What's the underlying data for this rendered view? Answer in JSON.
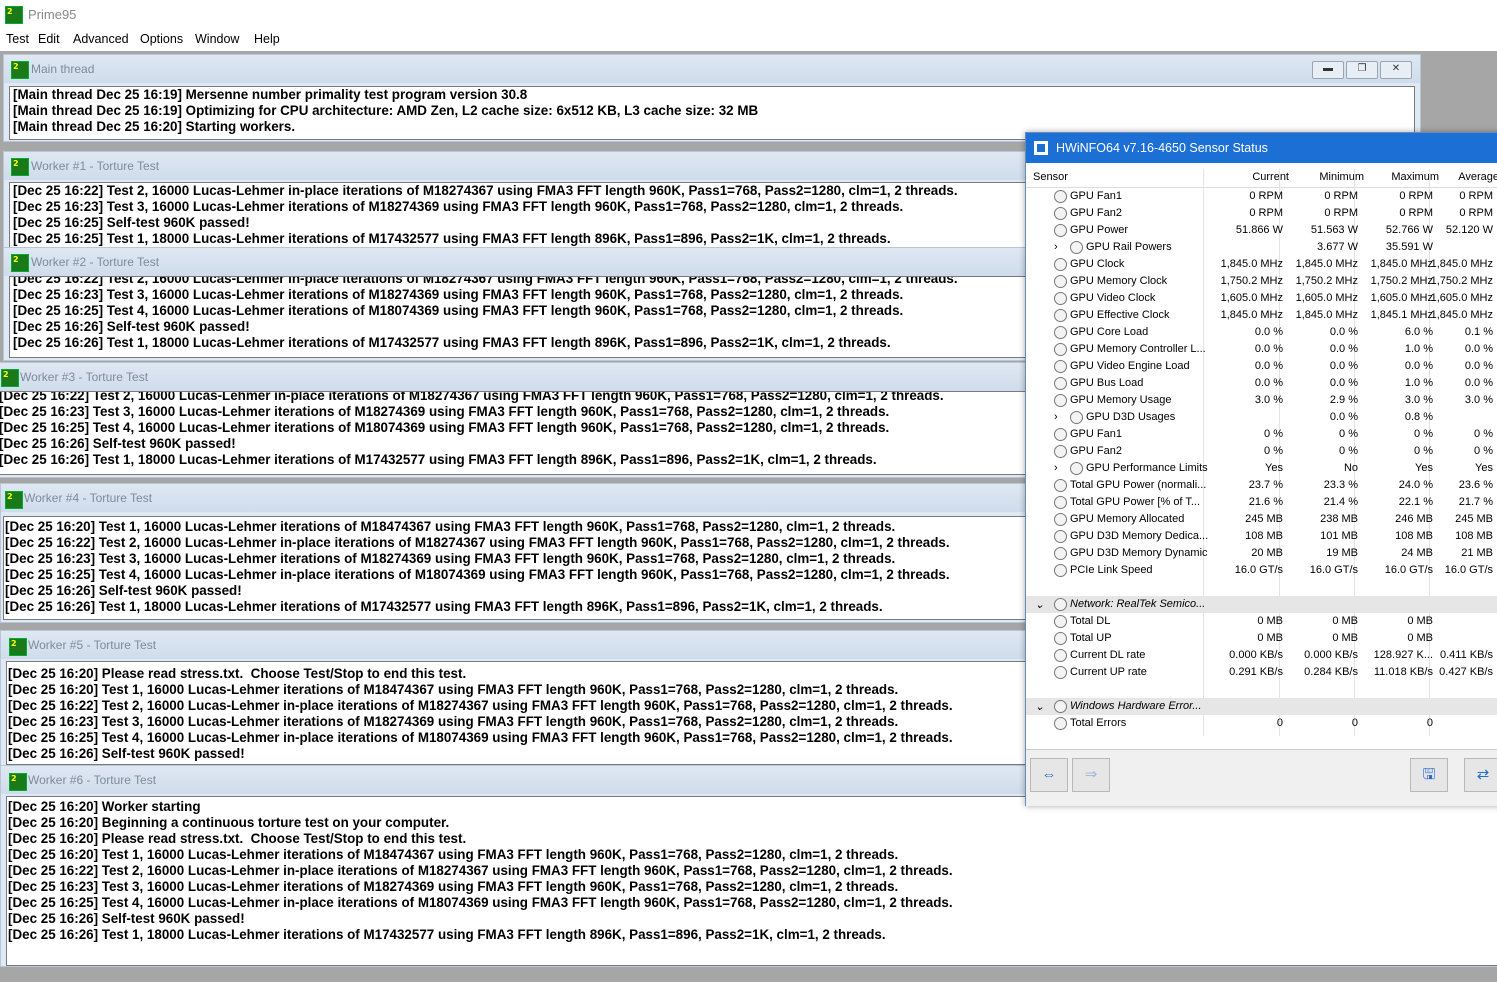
{
  "app": {
    "title": "Prime95"
  },
  "menu": [
    "Test",
    "Edit",
    "Advanced",
    "Options",
    "Window",
    "Help"
  ],
  "windows": [
    {
      "title": "Main thread",
      "lines": [
        "[Main thread Dec 25 16:19] Mersenne number primality test program version 30.8",
        "[Main thread Dec 25 16:19] Optimizing for CPU architecture: AMD Zen, L2 cache size: 6x512 KB, L3 cache size: 32 MB",
        "[Main thread Dec 25 16:20] Starting workers."
      ]
    },
    {
      "title": "Worker #1 - Torture Test",
      "lines": [
        "[Dec 25 16:22] Test 2, 16000 Lucas-Lehmer in-place iterations of M18274367 using FMA3 FFT length 960K, Pass1=768, Pass2=1280, clm=1, 2 threads.",
        "[Dec 25 16:23] Test 3, 16000 Lucas-Lehmer iterations of M18274369 using FMA3 FFT length 960K, Pass1=768, Pass2=1280, clm=1, 2 threads.",
        "[Dec 25 16:25] Self-test 960K passed!",
        "[Dec 25 16:25] Test 1, 18000 Lucas-Lehmer iterations of M17432577 using FMA3 FFT length 896K, Pass1=896, Pass2=1K, clm=1, 2 threads."
      ]
    },
    {
      "title": "Worker #2 - Torture Test",
      "lines": [
        "[Dec 25 16:22] Test 2, 16000 Lucas-Lehmer in-place iterations of M18274367 using FMA3 FFT length 960K, Pass1=768, Pass2=1280, clm=1, 2 threads.",
        "[Dec 25 16:23] Test 3, 16000 Lucas-Lehmer iterations of M18274369 using FMA3 FFT length 960K, Pass1=768, Pass2=1280, clm=1, 2 threads.",
        "[Dec 25 16:25] Test 4, 16000 Lucas-Lehmer iterations of M18074369 using FMA3 FFT length 960K, Pass1=768, Pass2=1280, clm=1, 2 threads.",
        "[Dec 25 16:26] Self-test 960K passed!",
        "[Dec 25 16:26] Test 1, 18000 Lucas-Lehmer iterations of M17432577 using FMA3 FFT length 896K, Pass1=896, Pass2=1K, clm=1, 2 threads."
      ]
    },
    {
      "title": "Worker #3 - Torture Test",
      "lines": [
        "[Dec 25 16:22] Test 2, 16000 Lucas-Lehmer in-place iterations of M18274367 using FMA3 FFT length 960K, Pass1=768, Pass2=1280, clm=1, 2 threads.",
        "[Dec 25 16:23] Test 3, 16000 Lucas-Lehmer iterations of M18274369 using FMA3 FFT length 960K, Pass1=768, Pass2=1280, clm=1, 2 threads.",
        "[Dec 25 16:25] Test 4, 16000 Lucas-Lehmer iterations of M18074369 using FMA3 FFT length 960K, Pass1=768, Pass2=1280, clm=1, 2 threads.",
        "[Dec 25 16:26] Self-test 960K passed!",
        "[Dec 25 16:26] Test 1, 18000 Lucas-Lehmer iterations of M17432577 using FMA3 FFT length 896K, Pass1=896, Pass2=1K, clm=1, 2 threads."
      ]
    },
    {
      "title": "Worker #4 - Torture Test",
      "lines": [
        "[Dec 25 16:20] Test 1, 16000 Lucas-Lehmer iterations of M18474367 using FMA3 FFT length 960K, Pass1=768, Pass2=1280, clm=1, 2 threads.",
        "[Dec 25 16:22] Test 2, 16000 Lucas-Lehmer in-place iterations of M18274367 using FMA3 FFT length 960K, Pass1=768, Pass2=1280, clm=1, 2 threads.",
        "[Dec 25 16:23] Test 3, 16000 Lucas-Lehmer iterations of M18274369 using FMA3 FFT length 960K, Pass1=768, Pass2=1280, clm=1, 2 threads.",
        "[Dec 25 16:25] Test 4, 16000 Lucas-Lehmer in-place iterations of M18074369 using FMA3 FFT length 960K, Pass1=768, Pass2=1280, clm=1, 2 threads.",
        "[Dec 25 16:26] Self-test 960K passed!",
        "[Dec 25 16:26] Test 1, 18000 Lucas-Lehmer iterations of M17432577 using FMA3 FFT length 896K, Pass1=896, Pass2=1K, clm=1, 2 threads."
      ]
    },
    {
      "title": "Worker #5 - Torture Test",
      "lines": [
        "[Dec 25 16:20] Please read stress.txt.  Choose Test/Stop to end this test.",
        "[Dec 25 16:20] Test 1, 16000 Lucas-Lehmer iterations of M18474367 using FMA3 FFT length 960K, Pass1=768, Pass2=1280, clm=1, 2 threads.",
        "[Dec 25 16:22] Test 2, 16000 Lucas-Lehmer in-place iterations of M18274367 using FMA3 FFT length 960K, Pass1=768, Pass2=1280, clm=1, 2 threads.",
        "[Dec 25 16:23] Test 3, 16000 Lucas-Lehmer iterations of M18274369 using FMA3 FFT length 960K, Pass1=768, Pass2=1280, clm=1, 2 threads.",
        "[Dec 25 16:25] Test 4, 16000 Lucas-Lehmer in-place iterations of M18074369 using FMA3 FFT length 960K, Pass1=768, Pass2=1280, clm=1, 2 threads.",
        "[Dec 25 16:26] Self-test 960K passed!"
      ]
    },
    {
      "title": "Worker #6 - Torture Test",
      "lines": [
        "[Dec 25 16:20] Worker starting",
        "[Dec 25 16:20] Beginning a continuous torture test on your computer.",
        "[Dec 25 16:20] Please read stress.txt.  Choose Test/Stop to end this test.",
        "[Dec 25 16:20] Test 1, 16000 Lucas-Lehmer iterations of M18474367 using FMA3 FFT length 960K, Pass1=768, Pass2=1280, clm=1, 2 threads.",
        "[Dec 25 16:22] Test 2, 16000 Lucas-Lehmer in-place iterations of M18274367 using FMA3 FFT length 960K, Pass1=768, Pass2=1280, clm=1, 2 threads.",
        "[Dec 25 16:23] Test 3, 16000 Lucas-Lehmer iterations of M18274369 using FMA3 FFT length 960K, Pass1=768, Pass2=1280, clm=1, 2 threads.",
        "[Dec 25 16:25] Test 4, 16000 Lucas-Lehmer in-place iterations of M18074369 using FMA3 FFT length 960K, Pass1=768, Pass2=1280, clm=1, 2 threads.",
        "[Dec 25 16:26] Self-test 960K passed!",
        "[Dec 25 16:26] Test 1, 18000 Lucas-Lehmer iterations of M17432577 using FMA3 FFT length 896K, Pass1=896, Pass2=1K, clm=1, 2 threads."
      ]
    }
  ],
  "hwinfo": {
    "title": "HWiNFO64 v7.16-4650 Sensor Status",
    "columns": [
      "Sensor",
      "Current",
      "Minimum",
      "Maximum",
      "Average"
    ],
    "rows": [
      {
        "name": "GPU Fan1",
        "icon": "fan-icon",
        "vals": [
          "0 RPM",
          "0 RPM",
          "0 RPM",
          "0 RPM"
        ]
      },
      {
        "name": "GPU Fan2",
        "icon": "fan-icon",
        "vals": [
          "0 RPM",
          "0 RPM",
          "0 RPM",
          "0 RPM"
        ]
      },
      {
        "name": "GPU Power",
        "icon": "lightning-icon",
        "vals": [
          "51.866 W",
          "51.563 W",
          "52.766 W",
          "52.120 W"
        ]
      },
      {
        "name": "GPU Rail Powers",
        "icon": "lightning-icon",
        "expand": true,
        "vals": [
          "",
          "3.677 W",
          "35.591 W",
          ""
        ]
      },
      {
        "name": "GPU Clock",
        "icon": "gauge-icon",
        "vals": [
          "1,845.0 MHz",
          "1,845.0 MHz",
          "1,845.0 MHz",
          "1,845.0 MHz"
        ]
      },
      {
        "name": "GPU Memory Clock",
        "icon": "gauge-icon",
        "vals": [
          "1,750.2 MHz",
          "1,750.2 MHz",
          "1,750.2 MHz",
          "1,750.2 MHz"
        ]
      },
      {
        "name": "GPU Video Clock",
        "icon": "gauge-icon",
        "vals": [
          "1,605.0 MHz",
          "1,605.0 MHz",
          "1,605.0 MHz",
          "1,605.0 MHz"
        ]
      },
      {
        "name": "GPU Effective Clock",
        "icon": "gauge-icon",
        "vals": [
          "1,845.0 MHz",
          "1,845.0 MHz",
          "1,845.1 MHz",
          "1,845.0 MHz"
        ]
      },
      {
        "name": "GPU Core Load",
        "icon": "gauge-icon",
        "vals": [
          "0.0 %",
          "0.0 %",
          "6.0 %",
          "0.1 %"
        ]
      },
      {
        "name": "GPU Memory Controller L...",
        "icon": "gauge-icon",
        "vals": [
          "0.0 %",
          "0.0 %",
          "1.0 %",
          "0.0 %"
        ]
      },
      {
        "name": "GPU Video Engine Load",
        "icon": "gauge-icon",
        "vals": [
          "0.0 %",
          "0.0 %",
          "0.0 %",
          "0.0 %"
        ]
      },
      {
        "name": "GPU Bus Load",
        "icon": "gauge-icon",
        "vals": [
          "0.0 %",
          "0.0 %",
          "1.0 %",
          "0.0 %"
        ]
      },
      {
        "name": "GPU Memory Usage",
        "icon": "gauge-icon",
        "vals": [
          "3.0 %",
          "2.9 %",
          "3.0 %",
          "3.0 %"
        ]
      },
      {
        "name": "GPU D3D Usages",
        "icon": "gauge-icon",
        "expand": true,
        "vals": [
          "",
          "0.0 %",
          "0.8 %",
          ""
        ]
      },
      {
        "name": "GPU Fan1",
        "icon": "gauge-icon",
        "vals": [
          "0 %",
          "0 %",
          "0 %",
          "0 %"
        ]
      },
      {
        "name": "GPU Fan2",
        "icon": "gauge-icon",
        "vals": [
          "0 %",
          "0 %",
          "0 %",
          "0 %"
        ]
      },
      {
        "name": "GPU Performance Limits",
        "icon": "gauge-icon",
        "expand": true,
        "vals": [
          "Yes",
          "No",
          "Yes",
          "Yes"
        ]
      },
      {
        "name": "Total GPU Power (normali...",
        "icon": "gauge-icon",
        "vals": [
          "23.7 %",
          "23.3 %",
          "24.0 %",
          "23.6 %"
        ]
      },
      {
        "name": "Total GPU Power [% of T...",
        "icon": "gauge-icon",
        "vals": [
          "21.6 %",
          "21.4 %",
          "22.1 %",
          "21.7 %"
        ]
      },
      {
        "name": "GPU Memory Allocated",
        "icon": "gauge-icon",
        "vals": [
          "245 MB",
          "238 MB",
          "246 MB",
          "245 MB"
        ]
      },
      {
        "name": "GPU D3D Memory Dedica...",
        "icon": "gauge-icon",
        "vals": [
          "108 MB",
          "101 MB",
          "108 MB",
          "108 MB"
        ]
      },
      {
        "name": "GPU D3D Memory Dynamic",
        "icon": "gauge-icon",
        "vals": [
          "20 MB",
          "19 MB",
          "24 MB",
          "21 MB"
        ]
      },
      {
        "name": "PCIe Link Speed",
        "icon": "gauge-icon",
        "vals": [
          "16.0 GT/s",
          "16.0 GT/s",
          "16.0 GT/s",
          "16.0 GT/s"
        ]
      },
      {
        "blank": true
      },
      {
        "name": "Network: RealTek Semico...",
        "icon": "network-icon",
        "section": true,
        "vals": [
          "",
          "",
          "",
          ""
        ]
      },
      {
        "name": "Total DL",
        "icon": "gauge-icon",
        "vals": [
          "0 MB",
          "0 MB",
          "0 MB",
          ""
        ]
      },
      {
        "name": "Total UP",
        "icon": "gauge-icon",
        "vals": [
          "0 MB",
          "0 MB",
          "0 MB",
          ""
        ]
      },
      {
        "name": "Current DL rate",
        "icon": "gauge-icon",
        "vals": [
          "0.000 KB/s",
          "0.000 KB/s",
          "128.927 K...",
          "0.411 KB/s"
        ]
      },
      {
        "name": "Current UP rate",
        "icon": "gauge-icon",
        "vals": [
          "0.291 KB/s",
          "0.284 KB/s",
          "11.018 KB/s",
          "0.427 KB/s"
        ]
      },
      {
        "blank": true
      },
      {
        "name": "Windows Hardware Error...",
        "icon": "chip-icon",
        "section": true,
        "vals": [
          "",
          "",
          "",
          ""
        ]
      },
      {
        "name": "Total Errors",
        "icon": "gauge-icon",
        "vals": [
          "0",
          "0",
          "0",
          ""
        ]
      }
    ]
  }
}
